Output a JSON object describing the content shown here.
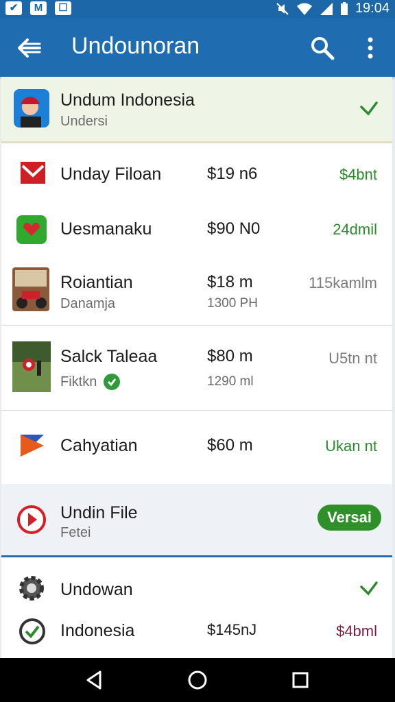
{
  "status": {
    "time": "19:04",
    "left_icons": [
      "mail-icon",
      "gmail-icon",
      "photo-icon"
    ],
    "right_icons": [
      "mute-icon",
      "wifi-icon",
      "signal-icon",
      "battery-icon"
    ]
  },
  "toolbar": {
    "title": "Undounoran",
    "icons": [
      "back-arrow-icon",
      "search-icon",
      "more-vert-icon"
    ]
  },
  "colors": {
    "primary": "#1f6db0",
    "accent_green": "#2b8a2b",
    "badge_green": "#2f8f28",
    "header_tint": "#eef5e6",
    "selected_tint": "#eef2f7"
  },
  "list": {
    "header": {
      "title": "Undum Indonesia",
      "subtitle": "Undersi",
      "icon": "profile-photo",
      "trailing_icon": "check-icon"
    },
    "rows": [
      {
        "title": "Unday Filoan",
        "price": "$19 n6",
        "right": "$4bnt",
        "icon": "red-envelope-icon"
      },
      {
        "title": "Uesmanaku",
        "price": "$90 N0",
        "right": "24dmil",
        "icon": "green-app-icon"
      },
      {
        "title": "Roiantian",
        "subtitle": "Danamja",
        "price": "$18 m",
        "price_sub": "1300 PH",
        "right": "115kamlm",
        "icon": "motorbike-photo"
      },
      {
        "title": "Salck Taleaa",
        "subtitle": "Fiktkn",
        "price": "$80 m",
        "price_sub": "1290 ml",
        "right": "U5tn nt",
        "icon": "field-photo"
      },
      {
        "title": "Cahyatian",
        "price": "$60 m",
        "right": "Ukan nt",
        "icon": "triangle-flag-icon"
      }
    ],
    "selected": {
      "title": "Undin File",
      "subtitle": "Fetei",
      "badge": "Versai",
      "icon": "play-circle-icon"
    },
    "bottom_rows": [
      {
        "title": "Undowan",
        "icon": "gear-icon",
        "trailing_icon": "check-icon"
      },
      {
        "title": "Indonesia",
        "price": "$145nJ",
        "right": "$4bml",
        "icon": "check-circle-icon"
      }
    ]
  },
  "navbar": {
    "icons": [
      "back-triangle-icon",
      "home-circle-icon",
      "recents-square-icon"
    ]
  }
}
